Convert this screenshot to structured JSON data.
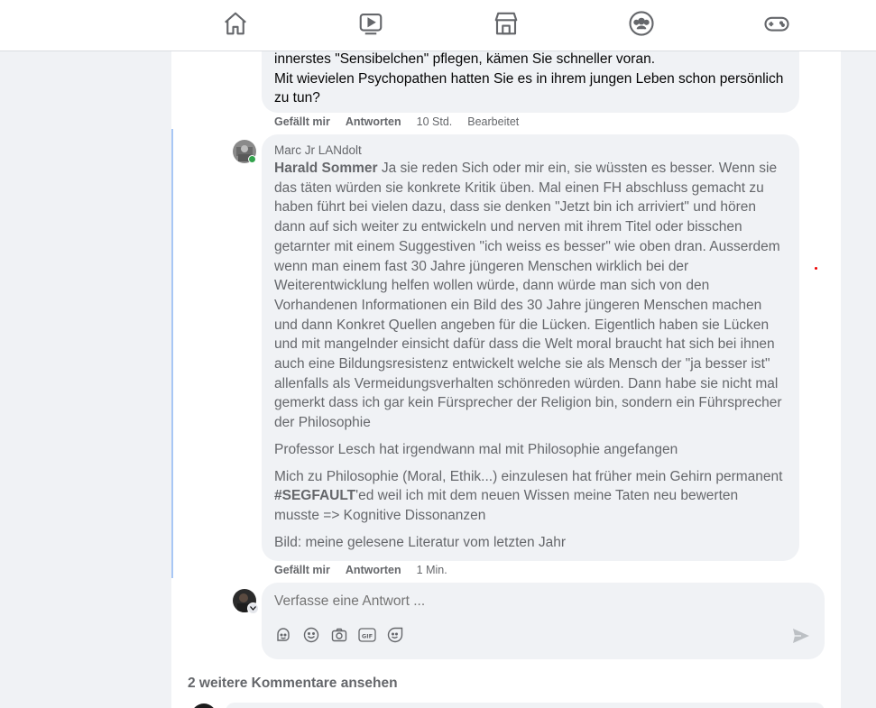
{
  "nav": {
    "icons": [
      "home-icon",
      "watch-icon",
      "marketplace-icon",
      "groups-icon",
      "gaming-icon"
    ]
  },
  "previous_comment": {
    "line1": "innerstes \"Sensibelchen\" pflegen, kämen Sie schneller voran.",
    "line2": "Mit wievielen Psychopathen hatten Sie es in ihrem jungen Leben schon persönlich zu tun?",
    "like_label": "Gefällt mir",
    "reply_label": "Antworten",
    "time": "10 Std.",
    "edited": "Bearbeitet"
  },
  "reply": {
    "author": "Marc Jr LANdolt",
    "mention": "Harald Sommer",
    "paragraph1": " Ja sie reden Sich oder mir ein, sie wüssten es besser. Wenn sie das täten würden sie konkrete Kritik üben. Mal einen FH abschluss gemacht zu haben führt bei vielen dazu, dass sie denken \"Jetzt bin ich arriviert\" und hören dann auf sich weiter zu entwickeln und nerven mit ihrem Titel oder bisschen getarnter mit einem Suggestiven \"ich weiss es besser\" wie oben dran. Ausserdem wenn man einem fast 30 Jahre jüngeren Menschen wirklich bei der Weiterentwicklung helfen wollen würde, dann würde man sich von den Vorhandenen Informationen ein Bild des 30 Jahre jüngeren Menschen machen und dann Konkret Quellen angeben für die Lücken. Eigentlich haben sie Lücken und mit mangelnder einsicht dafür dass die Welt moral braucht hat sich bei ihnen auch eine Bildungsresistenz entwickelt welche sie als Mensch der \"ja besser ist\" allenfalls als Vermeidungsverhalten schönreden würden. Dann habe sie nicht mal gemerkt dass ich gar kein Fürsprecher der Religion bin, sondern ein Führsprecher der Philosophie",
    "paragraph2": "Professor Lesch hat irgendwann mal mit Philosophie angefangen",
    "paragraph3_a": "Mich zu Philosophie (Moral, Ethik...) einzulesen hat früher mein Gehirn permanent ",
    "hashtag": "#SEGFAULT",
    "paragraph3_b": "'ed weil ich mit dem neuen Wissen meine Taten neu bewerten musste => Kognitive Dissonanzen",
    "paragraph4": "Bild: meine gelesene Literatur vom letzten Jahr",
    "like_label": "Gefällt mir",
    "reply_label": "Antworten",
    "time": "1 Min."
  },
  "composer": {
    "placeholder": "Verfasse eine Antwort ...",
    "tools": [
      "avatar-sticker-icon",
      "emoji-icon",
      "camera-icon",
      "gif-icon",
      "sticker-icon"
    ]
  },
  "more_comments_label": "2 weitere Kommentare ansehen",
  "colors": {
    "accent_line": "#a8c7f5",
    "bubble": "#f0f2f5",
    "muted_text": "#65676b",
    "online": "#31a24c"
  }
}
